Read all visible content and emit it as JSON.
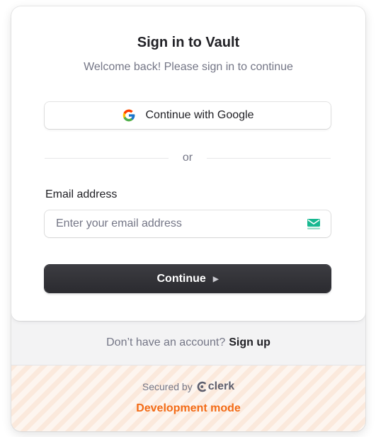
{
  "header": {
    "title": "Sign in to Vault",
    "subtitle": "Welcome back! Please sign in to continue"
  },
  "social": {
    "google_label": "Continue with Google",
    "icon": "google-icon"
  },
  "divider": {
    "text": "or"
  },
  "email": {
    "label": "Email address",
    "placeholder": "Enter your email address",
    "value": "",
    "icon": "mail-icon"
  },
  "primary_button": {
    "label": "Continue",
    "icon": "play-icon"
  },
  "footer": {
    "signup_prompt": "Don’t have an account?",
    "signup_link": "Sign up",
    "secured_by": "Secured by",
    "brand": "clerk",
    "dev_mode": "Development mode"
  },
  "colors": {
    "primary": "#2f3037",
    "dev_mode": "#f36b16",
    "muted_text": "#747686"
  }
}
